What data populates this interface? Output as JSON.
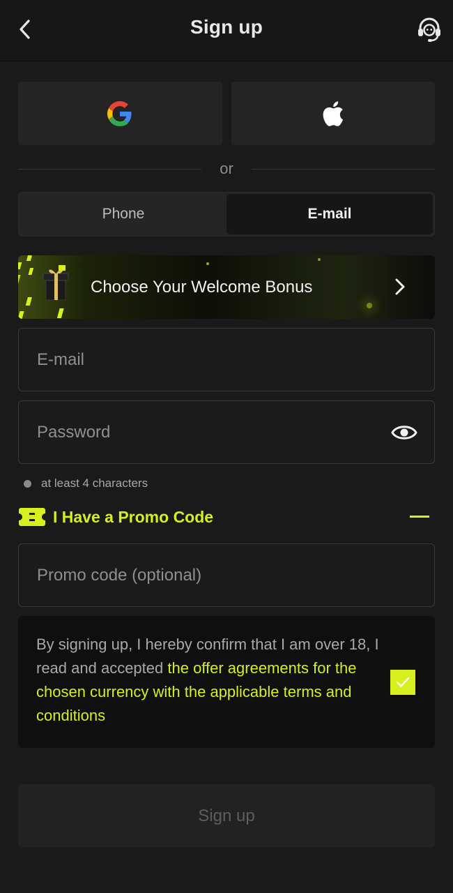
{
  "header": {
    "title": "Sign up",
    "back_icon": "chevron-left-icon",
    "support_icon": "headset-support-icon"
  },
  "social": {
    "google_icon": "google-icon",
    "apple_icon": "apple-icon"
  },
  "divider": {
    "text": "or"
  },
  "tabs": [
    {
      "label": "Phone",
      "active": false
    },
    {
      "label": "E-mail",
      "active": true
    }
  ],
  "bonus": {
    "label": "Choose Your Welcome Bonus",
    "icon": "gift-box-icon",
    "chevron_icon": "chevron-right-icon"
  },
  "form": {
    "email": {
      "placeholder": "E-mail",
      "value": ""
    },
    "password": {
      "placeholder": "Password",
      "value": "",
      "toggle_icon": "eye-icon"
    },
    "password_hint": "at least 4 characters",
    "promo_toggle": {
      "label": "I Have a Promo Code",
      "icon": "ticket-icon",
      "collapse_icon": "minus-icon"
    },
    "promo": {
      "placeholder": "Promo code (optional)",
      "value": ""
    }
  },
  "consent": {
    "text_plain": "By signing up, I hereby confirm that I am over 18, I read and accepted ",
    "text_link": "the offer agreements for the chosen currency with the applicable terms and conditions",
    "checked": true
  },
  "submit": {
    "label": "Sign up",
    "enabled": false
  },
  "colors": {
    "accent": "#d8ef1f",
    "background": "#1a1a1a",
    "surface": "#242424"
  }
}
